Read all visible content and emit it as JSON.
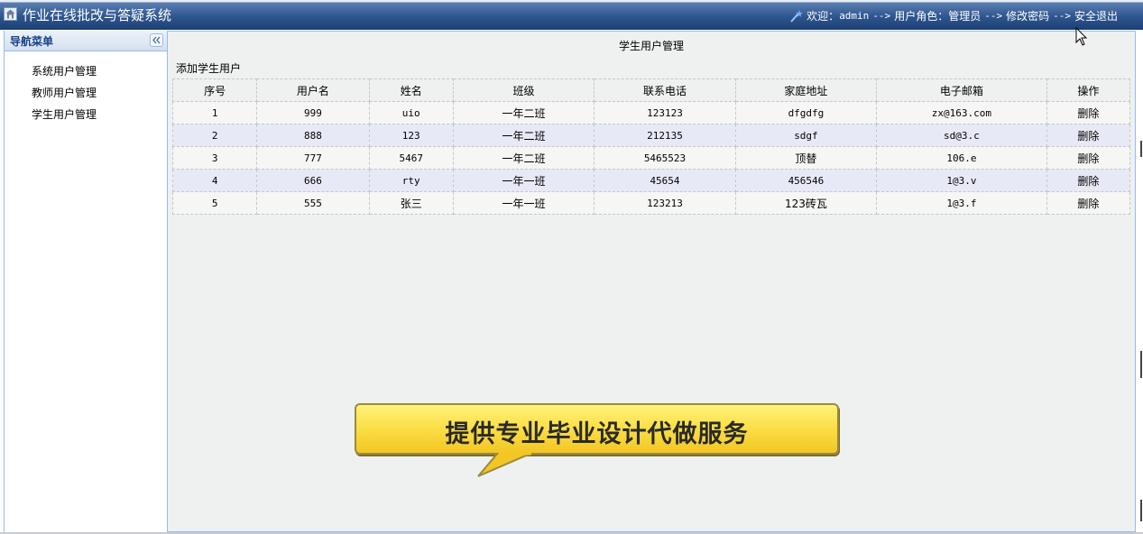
{
  "header": {
    "app_title": "作业在线批改与答疑系统",
    "welcome_label": "欢迎：",
    "username": "admin",
    "arrow": "-->",
    "role_label": "用户角色：",
    "role_value": "管理员",
    "change_password": "修改密码",
    "logout": "安全退出"
  },
  "sidebar": {
    "title": "导航菜单",
    "items": [
      {
        "label": "系统用户管理"
      },
      {
        "label": "教师用户管理"
      },
      {
        "label": "学生用户管理"
      }
    ]
  },
  "main": {
    "title": "学生用户管理",
    "add_link": "添加学生用户",
    "columns": [
      "序号",
      "用户名",
      "姓名",
      "班级",
      "联系电话",
      "家庭地址",
      "电子邮箱",
      "操作"
    ],
    "rows": [
      {
        "no": "1",
        "username": "999",
        "name": "uio",
        "class": "一年二班",
        "phone": "123123",
        "address": "dfgdfg",
        "email": "zx@163.com",
        "action": "删除"
      },
      {
        "no": "2",
        "username": "888",
        "name": "123",
        "class": "一年二班",
        "phone": "212135",
        "address": "sdgf",
        "email": "sd@3.c",
        "action": "删除"
      },
      {
        "no": "3",
        "username": "777",
        "name": "5467",
        "class": "一年二班",
        "phone": "5465523",
        "address": "顶替",
        "email": "106.e",
        "action": "删除"
      },
      {
        "no": "4",
        "username": "666",
        "name": "rty",
        "class": "一年一班",
        "phone": "45654",
        "address": "456546",
        "email": "1@3.v",
        "action": "删除"
      },
      {
        "no": "5",
        "username": "555",
        "name": "张三",
        "class": "一年一班",
        "phone": "123213",
        "address": "123砖瓦",
        "email": "1@3.f",
        "action": "删除"
      }
    ]
  },
  "promo": {
    "text": "提供专业毕业设计代做服务"
  },
  "colors": {
    "header_blue": "#2f5690",
    "nav_title": "#15428b",
    "panel_border": "#99bbe8",
    "row_even": "#e8e9f7",
    "callout_yellow": "#fbe04a"
  }
}
